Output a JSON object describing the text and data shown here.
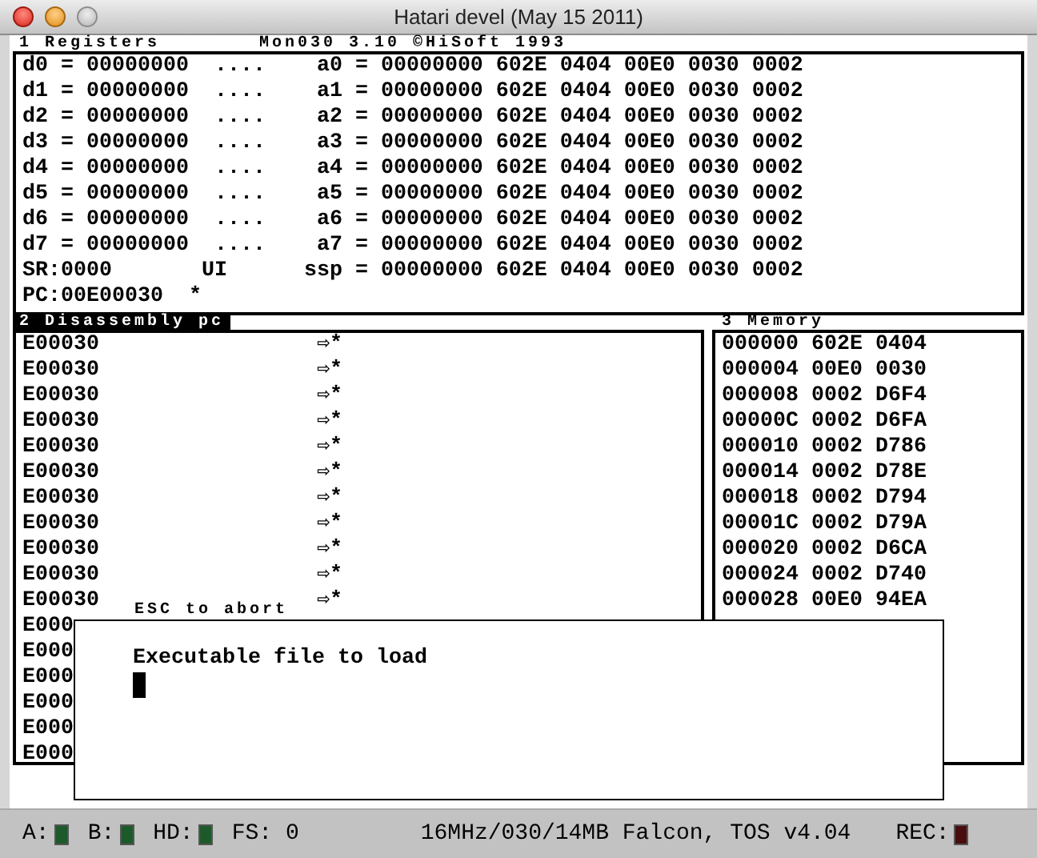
{
  "window": {
    "title": "Hatari devel (May 15 2011)"
  },
  "registers": {
    "title": "1 Registers",
    "header": "Mon030 3.10 ©HiSoft 1993",
    "lines": [
      "d0 = 00000000  ....    a0 = 00000000 602E 0404 00E0 0030 0002",
      "d1 = 00000000  ....    a1 = 00000000 602E 0404 00E0 0030 0002",
      "d2 = 00000000  ....    a2 = 00000000 602E 0404 00E0 0030 0002",
      "d3 = 00000000  ....    a3 = 00000000 602E 0404 00E0 0030 0002",
      "d4 = 00000000  ....    a4 = 00000000 602E 0404 00E0 0030 0002",
      "d5 = 00000000  ....    a5 = 00000000 602E 0404 00E0 0030 0002",
      "d6 = 00000000  ....    a6 = 00000000 602E 0404 00E0 0030 0002",
      "d7 = 00000000  ....    a7 = 00000000 602E 0404 00E0 0030 0002",
      "SR:0000       UI      ssp = 00000000 602E 0404 00E0 0030 0002",
      "PC:00E00030  *"
    ]
  },
  "disassembly": {
    "title": "2 Disassembly pc",
    "selected": true,
    "rows": [
      {
        "address": "E00030",
        "marker": "⇨*"
      },
      {
        "address": "E00030",
        "marker": "⇨*"
      },
      {
        "address": "E00030",
        "marker": "⇨*"
      },
      {
        "address": "E00030",
        "marker": "⇨*"
      },
      {
        "address": "E00030",
        "marker": "⇨*"
      },
      {
        "address": "E00030",
        "marker": "⇨*"
      },
      {
        "address": "E00030",
        "marker": "⇨*"
      },
      {
        "address": "E00030",
        "marker": "⇨*"
      },
      {
        "address": "E00030",
        "marker": "⇨*"
      },
      {
        "address": "E00030",
        "marker": "⇨*"
      },
      {
        "address": "E00030",
        "marker": "⇨*"
      },
      {
        "address": "E000"
      },
      {
        "address": "E000"
      },
      {
        "address": "E000"
      },
      {
        "address": "E000"
      },
      {
        "address": "E000"
      },
      {
        "address": "E000"
      }
    ]
  },
  "memory": {
    "title": "3 Memory",
    "selected": false,
    "rows": [
      "000000 602E 0404",
      "000004 00E0 0030",
      "000008 0002 D6F4",
      "00000C 0002 D6FA",
      "000010 0002 D786",
      "000014 0002 D78E",
      "000018 0002 D794",
      "00001C 0002 D79A",
      "000020 0002 D6CA",
      "000024 0002 D740",
      "000028 00E0 94EA"
    ]
  },
  "dialog": {
    "hint": "ESC to abort",
    "prompt": "Executable file to load"
  },
  "status_bar": {
    "items": [
      {
        "kind": "led",
        "label": "A:",
        "color": "#1d5a2b"
      },
      {
        "kind": "led",
        "label": "B:",
        "color": "#1d5a2b"
      },
      {
        "kind": "led",
        "label": "HD:",
        "color": "#1d5a2b"
      },
      {
        "kind": "text",
        "label": "FS: 0"
      },
      {
        "kind": "text",
        "label": "16MHz/030/14MB Falcon, TOS v4.04"
      },
      {
        "kind": "led",
        "label": "REC:",
        "color": "#4a0d0d"
      }
    ]
  }
}
